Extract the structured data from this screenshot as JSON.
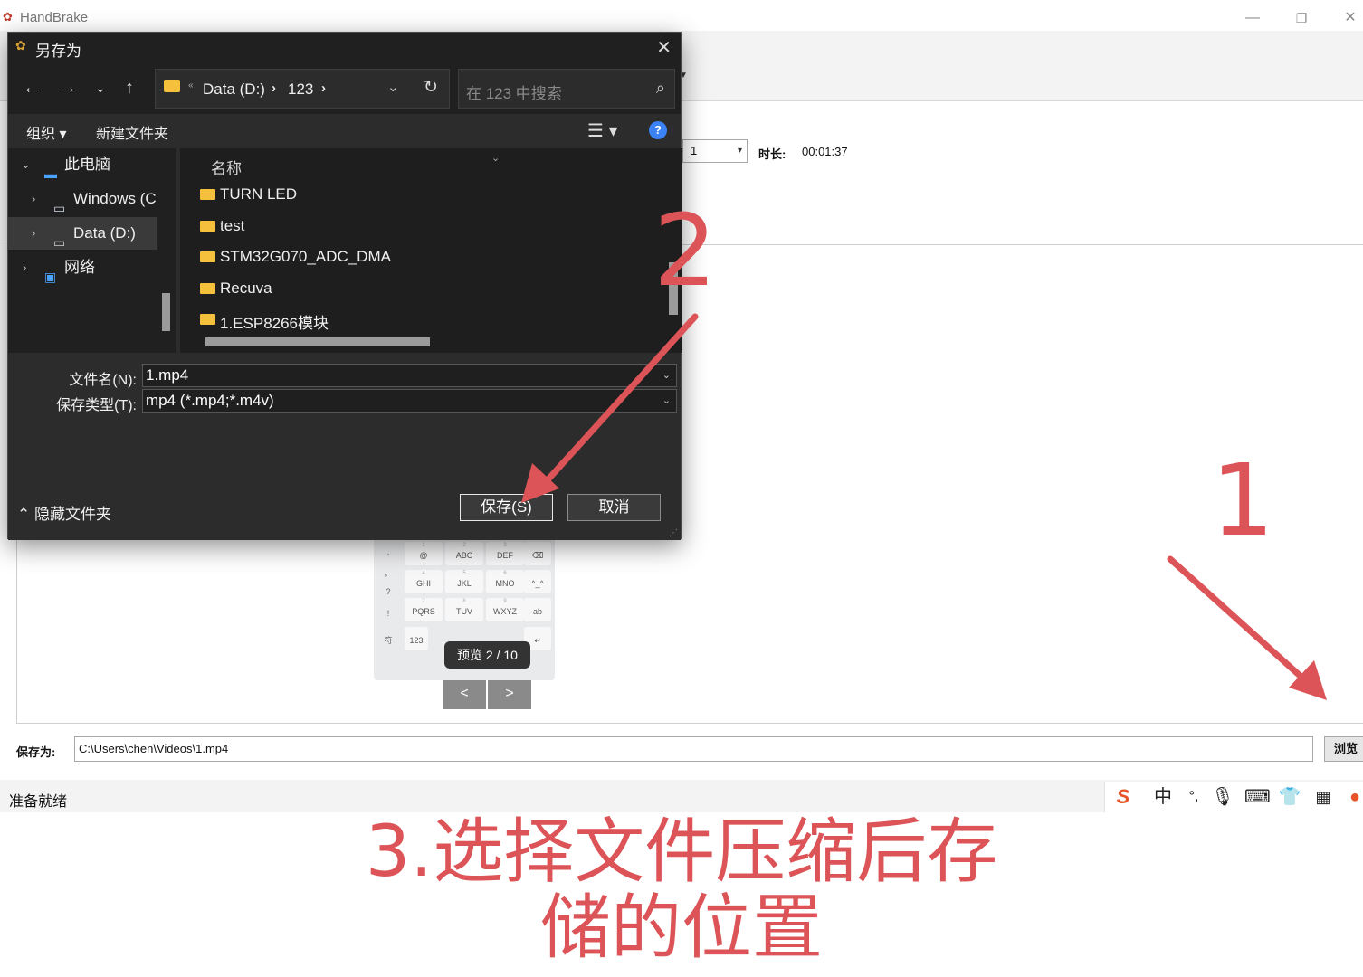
{
  "app": {
    "title": "HandBrake",
    "icon": "handbrake-logo-icon",
    "window_controls": [
      "minimize-icon",
      "restore-icon",
      "close-icon"
    ]
  },
  "source": {
    "chapter_value": "1",
    "duration_label": "时长:",
    "duration_value": "00:01:37"
  },
  "preview": {
    "keyboard_keys": [
      "@",
      "ABC",
      "DEF",
      "GHI",
      "JKL",
      "MNO",
      "PQRS",
      "TUV",
      "WXYZ",
      "ab",
      "123"
    ],
    "badge": "预览 2 / 10",
    "prev_label": "<",
    "next_label": ">"
  },
  "destination": {
    "label": "保存为:",
    "path": "C:\\Users\\chen\\Videos\\1.mp4",
    "browse_label": "浏览"
  },
  "status": {
    "text": "准备就绪",
    "ime_icons": [
      "sogou-icon",
      "chinese-mode-icon",
      "punctuation-icon",
      "microphone-icon",
      "keyboard-icon",
      "skin-icon",
      "toolbox-icon",
      "mascot-icon"
    ],
    "ime_mode": "中"
  },
  "dialog": {
    "title": "另存为",
    "address": {
      "segments": [
        "Data (D:)",
        "123"
      ]
    },
    "search_placeholder": "在 123 中搜索",
    "commands": {
      "organize": "组织",
      "new_folder": "新建文件夹"
    },
    "tree": [
      {
        "label": "此电脑",
        "icon": "computer-icon",
        "expanded": true
      },
      {
        "label": "Windows (C",
        "icon": "drive-icon"
      },
      {
        "label": "Data (D:)",
        "icon": "drive-icon",
        "selected": true
      },
      {
        "label": "网络",
        "icon": "network-icon"
      }
    ],
    "column_name": "名称",
    "files": [
      "TURN LED",
      "test",
      "STM32G070_ADC_DMA",
      "Recuva",
      "1.ESP8266模块"
    ],
    "filename_label": "文件名(N):",
    "filename_value": "1.mp4",
    "filetype_label": "保存类型(T):",
    "filetype_value": "mp4 (*.mp4;*.m4v)",
    "hide_folders": "隐藏文件夹",
    "save_label": "保存(S)",
    "cancel_label": "取消"
  },
  "annotations": {
    "step1": "1",
    "step2": "2",
    "caption_line1": "3.选择文件压缩后存",
    "caption_line2": "储的位置",
    "color": "#dc5457"
  }
}
